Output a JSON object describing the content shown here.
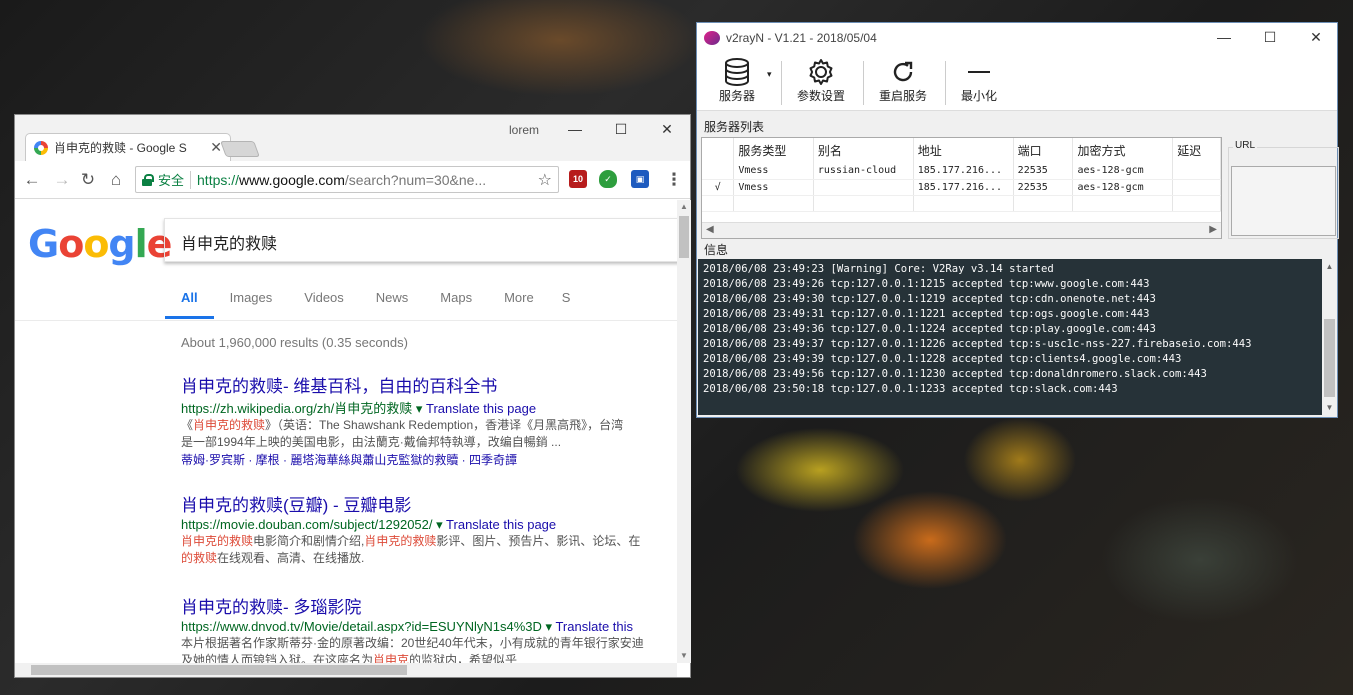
{
  "chrome": {
    "profile": "lorem",
    "tab_title": "肖申克的救赎 - Google S",
    "secure_label": "安全",
    "url_https": "https://",
    "url_host": "www.google.com",
    "url_path": "/search?num=30&ne...",
    "ext_badge": "10"
  },
  "google": {
    "query": "肖申克的救赎",
    "tabs": [
      "All",
      "Images",
      "Videos",
      "News",
      "Maps",
      "More",
      "S"
    ],
    "result_stats": "About 1,960,000 results (0.35 seconds)",
    "results": [
      {
        "title": "肖申克的救赎- 维基百科，自由的百科全书",
        "url": "https://zh.wikipedia.org/zh/肖申克的救赎",
        "translate": "Translate this page",
        "snippet1_pre": "《",
        "snippet1_em": "肖申克的救赎",
        "snippet1_post": "》（英语：The Shawshank Redemption，香港译《月黑高飛》，台湾",
        "snippet2": "是一部1994年上映的美国电影，由法蘭克·戴倫邦特執導，改编自暢銷 ...",
        "links": "蒂姆·罗宾斯 · 摩根 · 麗塔海華絲與蕭山克監獄的救贖 · 四季奇譚"
      },
      {
        "title": "肖申克的救赎(豆瓣) - 豆瓣电影",
        "url": "https://movie.douban.com/subject/1292052/",
        "translate": "Translate this page",
        "snippet1_em": "肖申克的救赎",
        "snippet1_mid": "电影简介和剧情介绍,",
        "snippet1_em2": "肖申克的救赎",
        "snippet1_post": "影评、图片、预告片、影讯、论坛、在",
        "snippet2_em": "的救赎",
        "snippet2_post": "在线观看、高清、在线播放."
      },
      {
        "title": "肖申克的救赎- 多瑙影院",
        "url": "https://www.dnvod.tv/Movie/detail.aspx?id=ESUYNlyN1s4%3D",
        "translate": "Translate this",
        "snippet1": "本片根据著名作家斯蒂芬·金的原著改编：20世纪40年代末，小有成就的青年银行家安迪",
        "snippet2_pre": "及她的情人而锒铛入狱。在这座名为",
        "snippet2_em": "肖申克",
        "snippet2_post": "的监狱内，希望似乎"
      }
    ]
  },
  "v2": {
    "title": "v2rayN - V1.21 - 2018/05/04",
    "toolbar": {
      "servers": "服务器",
      "settings": "参数设置",
      "restart": "重启服务",
      "minimize": "最小化"
    },
    "server_list_label": "服务器列表",
    "columns": [
      "服务类型",
      "别名",
      "地址",
      "端口",
      "加密方式",
      "延迟"
    ],
    "rows": [
      {
        "mark": "",
        "type": "Vmess",
        "alias": "russian-cloud",
        "addr": "185.177.216...",
        "port": "22535",
        "enc": "aes-128-gcm",
        "delay": ""
      },
      {
        "mark": "√",
        "type": "Vmess",
        "alias": "",
        "addr": "185.177.216...",
        "port": "22535",
        "enc": "aes-128-gcm",
        "delay": ""
      }
    ],
    "url_label": "URL",
    "info_label": "信息",
    "log": [
      "2018/06/08 23:49:23 [Warning] Core: V2Ray v3.14 started",
      "2018/06/08 23:49:26 tcp:127.0.0.1:1215 accepted tcp:www.google.com:443",
      "2018/06/08 23:49:30 tcp:127.0.0.1:1219 accepted tcp:cdn.onenote.net:443",
      "2018/06/08 23:49:31 tcp:127.0.0.1:1221 accepted tcp:ogs.google.com:443",
      "2018/06/08 23:49:36 tcp:127.0.0.1:1224 accepted tcp:play.google.com:443",
      "2018/06/08 23:49:37 tcp:127.0.0.1:1226 accepted tcp:s-usc1c-nss-227.firebaseio.com:443",
      "2018/06/08 23:49:39 tcp:127.0.0.1:1228 accepted tcp:clients4.google.com:443",
      "2018/06/08 23:49:56 tcp:127.0.0.1:1230 accepted tcp:donaldnromero.slack.com:443",
      "2018/06/08 23:50:18 tcp:127.0.0.1:1233 accepted tcp:slack.com:443"
    ]
  }
}
